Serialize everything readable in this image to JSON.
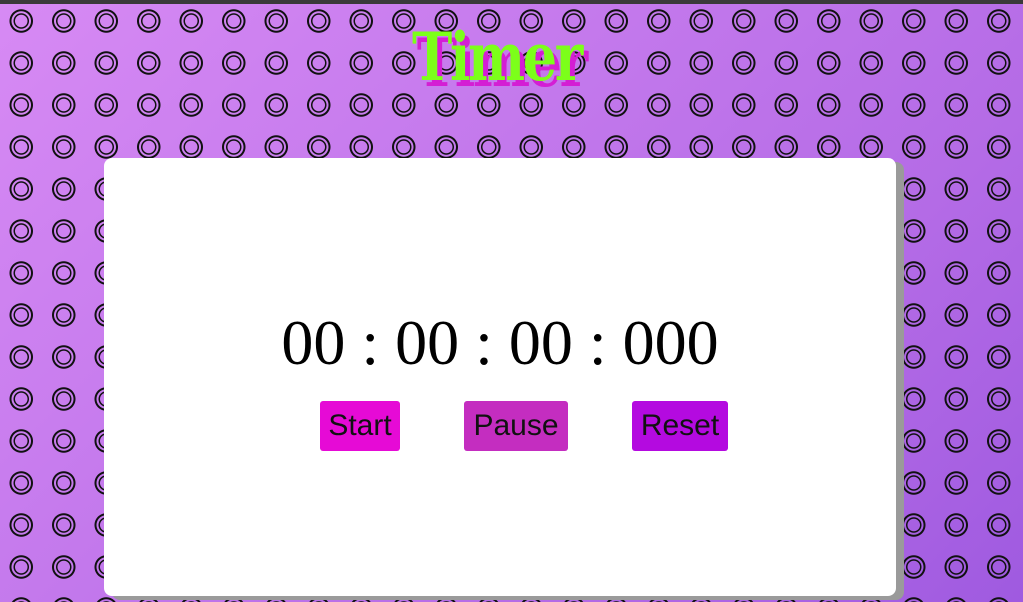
{
  "app": {
    "title": "Timer"
  },
  "timer": {
    "display": "00 : 00 : 00 : 000"
  },
  "controls": {
    "start_label": "Start",
    "pause_label": "Pause",
    "reset_label": "Reset"
  },
  "background": {
    "pattern_icon": "stopwatch-icon",
    "base_color": "#c07ae8"
  },
  "colors": {
    "title": "#7cff1a",
    "title_shadow": "#d41ed4",
    "start": "#e60ad6",
    "pause": "#c42dc0",
    "reset": "#b40ae0"
  }
}
